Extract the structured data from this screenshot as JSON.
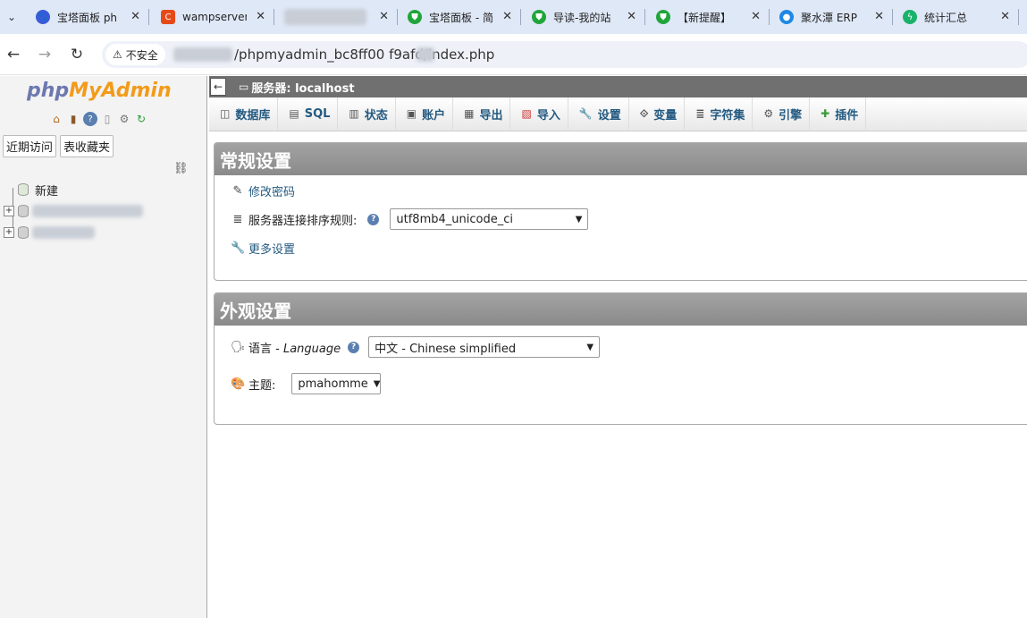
{
  "browser": {
    "tabs": [
      {
        "title": "宝塔面板 ph",
        "favicon": "paw-icon",
        "color": "#3a5bd9"
      },
      {
        "title": "wampserver",
        "favicon": "c-icon",
        "color": "#e64a19"
      },
      {
        "title": "",
        "favicon": "blurred",
        "color": "#c8cdd6"
      },
      {
        "title": "宝塔面板 - 简",
        "favicon": "shield-icon",
        "color": "#20a53a"
      },
      {
        "title": "导读-我的站",
        "favicon": "shield-icon",
        "color": "#20a53a"
      },
      {
        "title": "【新提醒】",
        "favicon": "shield-icon",
        "color": "#20a53a"
      },
      {
        "title": "聚水潭 ERP",
        "favicon": "drop-icon",
        "color": "#1e88e5"
      },
      {
        "title": "统计汇总",
        "favicon": "bolt-shield-icon",
        "color": "#18b26b"
      }
    ],
    "security_label": "不安全",
    "url": "/phpmyadmin_bc8ff00        f9afd/index.php"
  },
  "left_nav": {
    "logo_php": "php",
    "logo_myadmin": "MyAdmin",
    "tab_recent": "近期访问",
    "tab_favorites": "表收藏夹",
    "tree_new": "新建"
  },
  "main": {
    "server_label": "服务器: localhost",
    "menu": [
      {
        "label": "数据库",
        "icon": "database-icon"
      },
      {
        "label": "SQL",
        "icon": "sql-icon"
      },
      {
        "label": "状态",
        "icon": "status-icon"
      },
      {
        "label": "账户",
        "icon": "accounts-icon"
      },
      {
        "label": "导出",
        "icon": "export-icon"
      },
      {
        "label": "导入",
        "icon": "import-icon"
      },
      {
        "label": "设置",
        "icon": "wrench-icon"
      },
      {
        "label": "变量",
        "icon": "variables-icon"
      },
      {
        "label": "字符集",
        "icon": "charset-icon"
      },
      {
        "label": "引擎",
        "icon": "engine-icon"
      },
      {
        "label": "插件",
        "icon": "plugin-icon"
      }
    ],
    "general": {
      "title": "常规设置",
      "change_password": "修改密码",
      "collation_label": "服务器连接排序规则:",
      "collation_value": "utf8mb4_unicode_ci",
      "more_settings": "更多设置"
    },
    "appearance": {
      "title": "外观设置",
      "language_label": "语言 - ",
      "language_label_en": "Language",
      "language_value": "中文 - Chinese simplified",
      "theme_label": "主题:",
      "theme_value": "pmahomme"
    }
  }
}
